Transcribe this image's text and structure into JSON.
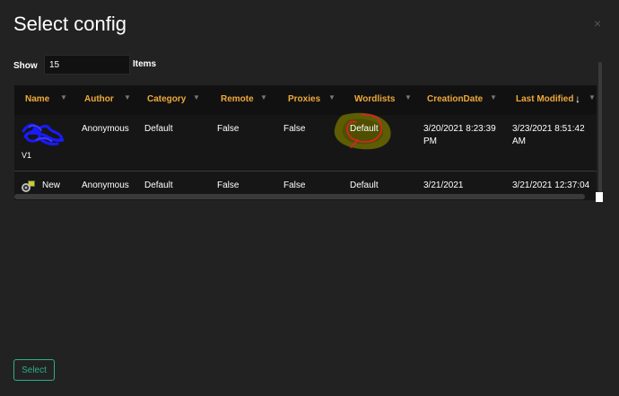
{
  "dialog": {
    "title": "Select config",
    "close_glyph": "×"
  },
  "show": {
    "label": "Show",
    "value": "15",
    "items_label": "Items"
  },
  "table": {
    "columns": [
      {
        "label": "Name"
      },
      {
        "label": "Author"
      },
      {
        "label": "Category"
      },
      {
        "label": "Remote"
      },
      {
        "label": "Proxies"
      },
      {
        "label": "Wordlists"
      },
      {
        "label": "CreationDate"
      },
      {
        "label": "Last Modified"
      }
    ],
    "sort_glyph": "↓",
    "filter_glyph": "▼",
    "rows": [
      {
        "name": "V1",
        "author": "Anonymous",
        "category": "Default",
        "remote": "False",
        "proxies": "False",
        "wordlists": "Default",
        "creation_date_line1": "3/20/2021 8:23:39",
        "creation_date_line2": "PM",
        "last_modified_line1": "3/23/2021 8:51:42",
        "last_modified_line2": "AM"
      },
      {
        "name": "New",
        "author": "Anonymous",
        "category": "Default",
        "remote": "False",
        "proxies": "False",
        "wordlists": "Default",
        "creation_date": "3/21/2021",
        "last_modified": "3/21/2021 12:37:04"
      }
    ],
    "icons": {
      "row1": "redacted-scribble-icon",
      "row2": "config-icon"
    }
  },
  "footer": {
    "select_label": "Select"
  },
  "colors": {
    "background": "#222222",
    "header_bg": "#111111",
    "header_text": "#f0a93c",
    "accent": "#2bb08a",
    "annotation_red": "#e0202a",
    "annotation_yellow": "#6b6a00",
    "scribble_blue": "#1a1aff"
  }
}
